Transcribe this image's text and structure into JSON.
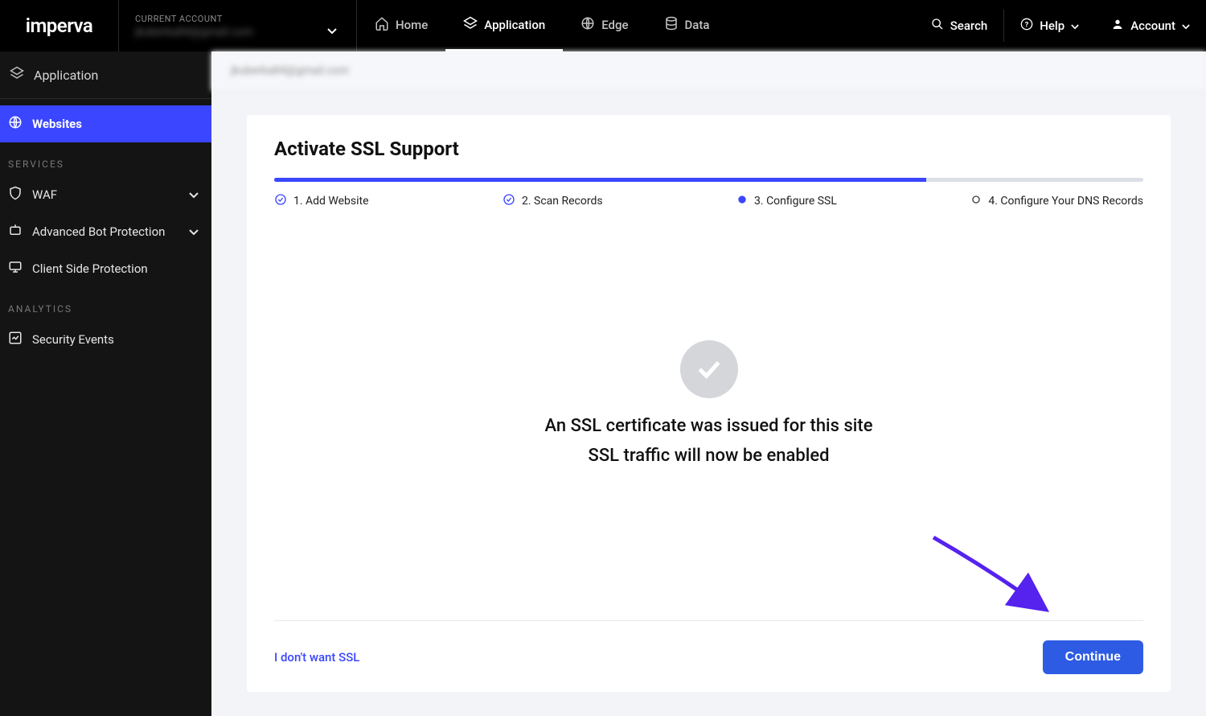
{
  "brand": "imperva",
  "account_selector": {
    "label": "CURRENT ACCOUNT",
    "email": "jkuberka84@gmail.com"
  },
  "nav_tabs": {
    "home": "Home",
    "application": "Application",
    "edge": "Edge",
    "data": "Data"
  },
  "right": {
    "search": "Search",
    "help": "Help",
    "account": "Account"
  },
  "sidebar": {
    "top": "Application",
    "websites": "Websites",
    "section_services": "SERVICES",
    "waf": "WAF",
    "bot": "Advanced Bot Protection",
    "csp": "Client Side Protection",
    "section_analytics": "ANALYTICS",
    "sec_events": "Security Events"
  },
  "breadcrumb": "jkuberka84@gmail.com",
  "panel": {
    "title": "Activate SSL Support",
    "steps": {
      "s1": "1. Add Website",
      "s2": "2. Scan Records",
      "s3": "3. Configure SSL",
      "s4": "4. Configure Your DNS Records"
    },
    "status_line1": "An SSL certificate was issued for this site",
    "status_line2": "SSL traffic will now be enabled",
    "skip_link": "I don't want SSL",
    "continue": "Continue"
  }
}
